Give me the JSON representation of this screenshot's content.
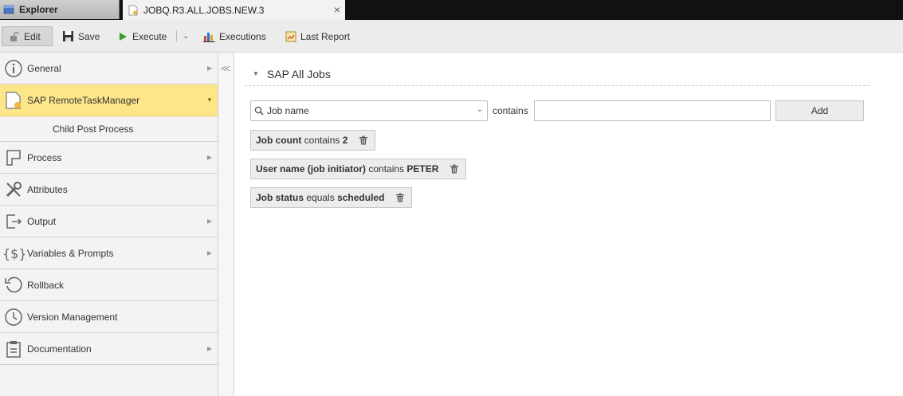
{
  "tabs": [
    {
      "label": "Explorer",
      "icon": "explorer-icon",
      "active": false
    },
    {
      "label": "JOBQ.R3.ALL.JOBS.NEW.3",
      "icon": "job-document-icon",
      "active": true,
      "close_glyph": "×"
    }
  ],
  "toolbar": {
    "edit_label": "Edit",
    "save_label": "Save",
    "execute_label": "Execute",
    "executions_label": "Executions",
    "last_report_label": "Last Report"
  },
  "sidebar": {
    "items": [
      {
        "label": "General",
        "icon": "info-icon",
        "has_arrow": true
      },
      {
        "label": "SAP RemoteTaskManager",
        "icon": "document-icon",
        "has_arrow": true,
        "active": true
      },
      {
        "label": "Child Post Process",
        "sub": true
      },
      {
        "label": "Process",
        "icon": "process-icon",
        "has_arrow": true
      },
      {
        "label": "Attributes",
        "icon": "wrench-icon",
        "has_arrow": false
      },
      {
        "label": "Output",
        "icon": "output-icon",
        "has_arrow": true
      },
      {
        "label": "Variables & Prompts",
        "icon": "variables-icon",
        "has_arrow": true
      },
      {
        "label": "Rollback",
        "icon": "rollback-icon",
        "has_arrow": false
      },
      {
        "label": "Version Management",
        "icon": "clock-icon",
        "has_arrow": false
      },
      {
        "label": "Documentation",
        "icon": "clipboard-icon",
        "has_arrow": true
      }
    ],
    "collapse_glyph": "<<"
  },
  "section": {
    "title": "SAP All Jobs"
  },
  "filter": {
    "field_value": "Job name",
    "operator": "contains",
    "value": "",
    "add_label": "Add"
  },
  "criteria": [
    {
      "field": "Job count",
      "operator": "contains",
      "value": "2"
    },
    {
      "field": "User name (job initiator)",
      "operator": "contains",
      "value": "PETER"
    },
    {
      "field": "Job status",
      "operator": "equals",
      "value": "scheduled"
    }
  ],
  "colors": {
    "active_item_bg": "#fde68a",
    "execute_green": "#3a9a2c",
    "tab_bar_bg": "#111111"
  }
}
